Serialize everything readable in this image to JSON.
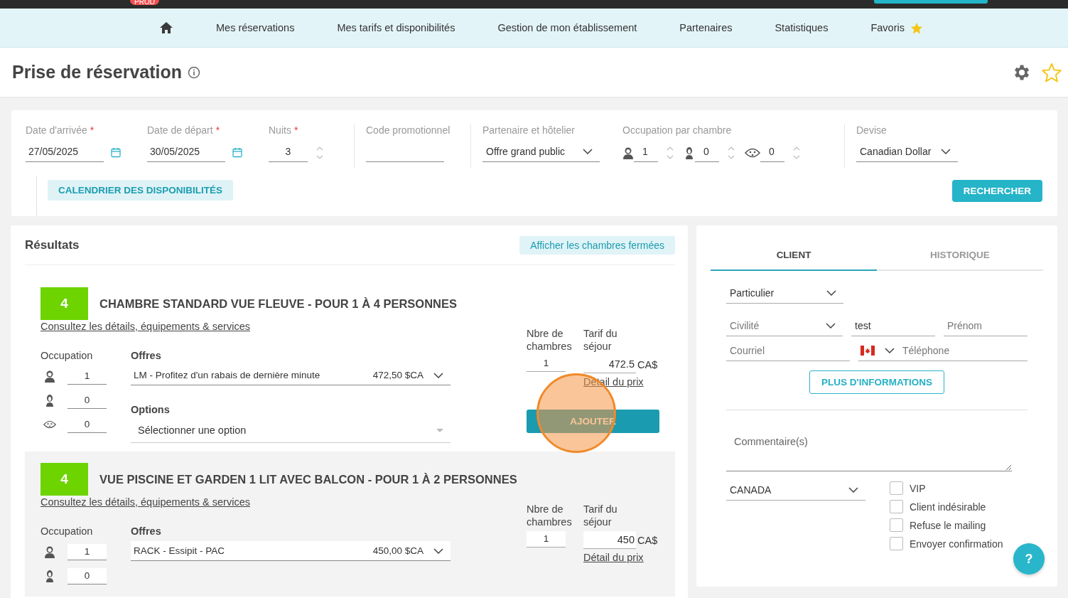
{
  "top_bar": {
    "badge": "PROD"
  },
  "nav": {
    "items": [
      {
        "kind": "home"
      },
      {
        "kind": "link",
        "label": "Mes réservations"
      },
      {
        "kind": "link",
        "label": "Mes tarifs et disponibilités"
      },
      {
        "kind": "link",
        "label": "Gestion de mon établissement"
      },
      {
        "kind": "link",
        "label": "Partenaires"
      },
      {
        "kind": "link",
        "label": "Statistiques"
      },
      {
        "kind": "favorites",
        "label": "Favoris"
      }
    ]
  },
  "page": {
    "title": "Prise de réservation"
  },
  "search": {
    "arrival": {
      "label": "Date d'arrivée",
      "required_mark": "*",
      "value": "27/05/2025"
    },
    "departure": {
      "label": "Date de départ",
      "required_mark": "*",
      "value": "30/05/2025"
    },
    "nights": {
      "label": "Nuits",
      "required_mark": "*",
      "value": "3"
    },
    "promo": {
      "label": "Code promotionnel"
    },
    "partner": {
      "label": "Partenaire et hôtelier",
      "value": "Offre grand public"
    },
    "occupancy": {
      "label": "Occupation par chambre",
      "guests": [
        {
          "kind": "adult",
          "value": "1"
        },
        {
          "kind": "child",
          "value": "0"
        },
        {
          "kind": "baby",
          "value": "0"
        }
      ]
    },
    "currency": {
      "label": "Devise",
      "value": "Canadian Dollar"
    },
    "calendar_button": "CALENDRIER DES DISPONIBILITÉS",
    "search_button": "RECHERCHER"
  },
  "results": {
    "title": "Résultats",
    "toggle_button": "Afficher les chambres fermées",
    "rooms": [
      {
        "hovered": false,
        "count": "4",
        "name": "CHAMBRE STANDARD VUE FLEUVE - POUR 1 À 4 PERSONNES",
        "details_link": "Consultez les détails, équipements & services",
        "occupation_label": "Occupation",
        "guests": [
          {
            "kind": "adult",
            "value": "1"
          },
          {
            "kind": "child",
            "value": "0"
          },
          {
            "kind": "baby",
            "value": "0"
          }
        ],
        "offers_label": "Offres",
        "offer": {
          "name": "LM - Profitez d'un rabais de dernière minute",
          "price": "472,50 $CA"
        },
        "options_label": "Options",
        "options_placeholder": "Sélectionner une option",
        "rooms_label": "Nbre de chambres",
        "rooms_value": "1",
        "price_label": "Tarif du séjour",
        "price": "472.5",
        "currency": "CA$",
        "price_detail": "Détail du prix",
        "add_button": {
          "label": "AJOUTER",
          "clicked": true
        }
      },
      {
        "hovered": true,
        "count": "4",
        "name": "VUE PISCINE ET GARDEN 1 LIT AVEC BALCON - POUR 1 À 2 PERSONNES",
        "details_link": "Consultez les détails, équipements & services",
        "occupation_label": "Occupation",
        "guests": [
          {
            "kind": "adult",
            "value": "1"
          },
          {
            "kind": "child",
            "value": "0"
          }
        ],
        "offers_label": "Offres",
        "offer": {
          "name": "RACK - Essipit - PAC",
          "price": "450,00 $CA"
        },
        "rooms_label": "Nbre de chambres",
        "rooms_value": "1",
        "price_label": "Tarif du séjour",
        "price": "450",
        "currency": "CA$",
        "price_detail": "Détail du prix"
      }
    ]
  },
  "client": {
    "tabs": [
      {
        "label": "CLIENT",
        "selected": true
      },
      {
        "label": "HISTORIQUE",
        "selected": false
      }
    ],
    "type": {
      "value": "Particulier"
    },
    "civility": {
      "placeholder": "Civilité"
    },
    "last_name": {
      "value": "test"
    },
    "first_name": {
      "placeholder": "Prénom"
    },
    "email": {
      "placeholder": "Courriel"
    },
    "phone": {
      "placeholder": "Téléphone"
    },
    "more_button": "PLUS D'INFORMATIONS",
    "comment": {
      "placeholder": "Commentaire(s)"
    },
    "country": {
      "value": "CANADA"
    },
    "flags": [
      {
        "label": "VIP",
        "checked": false
      },
      {
        "label": "Client indésirable",
        "checked": false
      },
      {
        "label": "Refuse le mailing",
        "checked": false
      },
      {
        "label": "Envoyer confirmation",
        "checked": false
      }
    ]
  },
  "help_button": "?"
}
